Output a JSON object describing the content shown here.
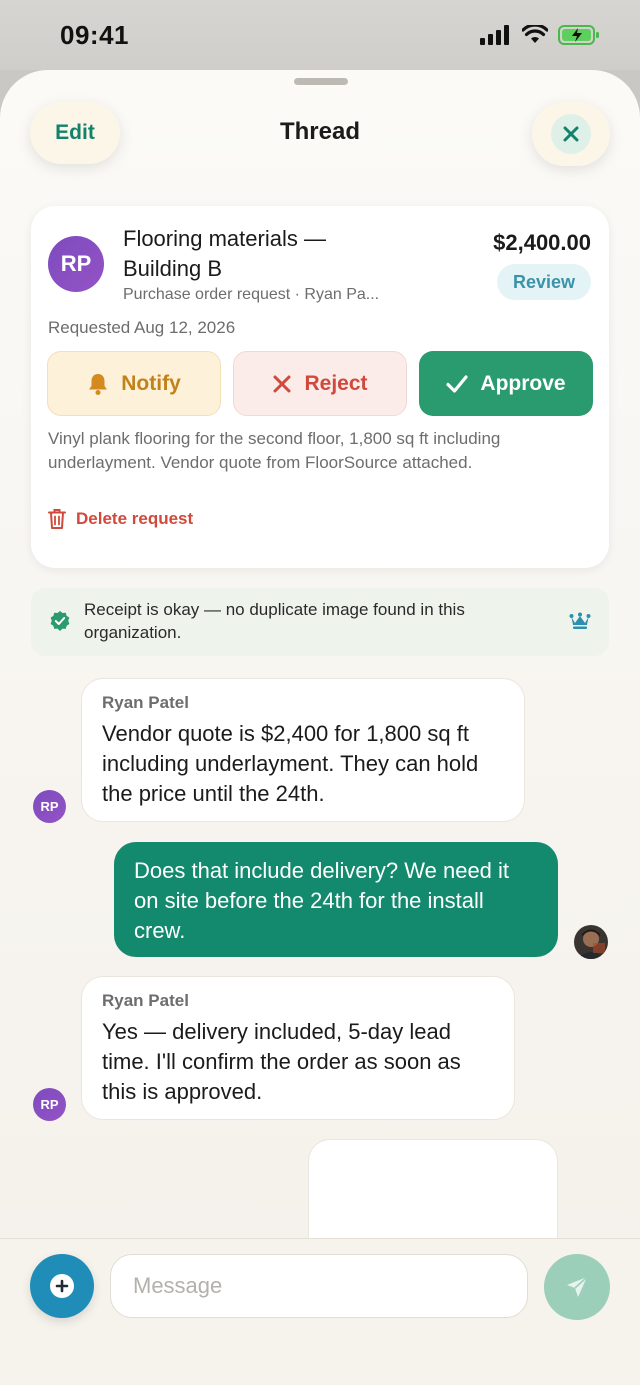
{
  "status_bar": {
    "time": "09:41"
  },
  "sheet": {
    "title": "Thread",
    "edit_label": "Edit"
  },
  "request": {
    "avatar_initials": "RP",
    "title": "Flooring materials — Building B",
    "subtitle": "Purchase order request · Ryan Pa...",
    "amount": "$2,400.00",
    "status_badge": "Review",
    "requested": "Requested Aug 12, 2026",
    "actions": {
      "notify": "Notify",
      "reject": "Reject",
      "approve": "Approve"
    },
    "description": "Vinyl plank flooring for the second floor, 1,800 sq ft including underlayment. Vendor quote from FloorSource attached.",
    "delete_label": "Delete request"
  },
  "receipt_check": {
    "text": "Receipt is okay — no duplicate image found in this organization."
  },
  "messages": [
    {
      "sender": "Ryan Patel",
      "avatar": "RP",
      "text": "Vendor quote is $2,400 for 1,800 sq ft including underlayment. They can hold the price until the 24th."
    },
    {
      "sender": "",
      "text": "Does that include delivery? We need it on site before the 24th for the install crew."
    },
    {
      "sender": "Ryan Patel",
      "avatar": "RP",
      "text": "Yes — delivery included, 5-day lead time. I'll confirm the order as soon as this is approved."
    }
  ],
  "composer": {
    "placeholder": "Message"
  },
  "colors": {
    "accent_green": "#2a9a6f",
    "outgoing_bubble": "#138a6d",
    "avatar_purple": "#8450c1",
    "reject_red": "#cf4a3c",
    "notify_amber": "#c2821a",
    "review_blue": "#3a93a9",
    "plus_blue": "#1f8db7"
  }
}
